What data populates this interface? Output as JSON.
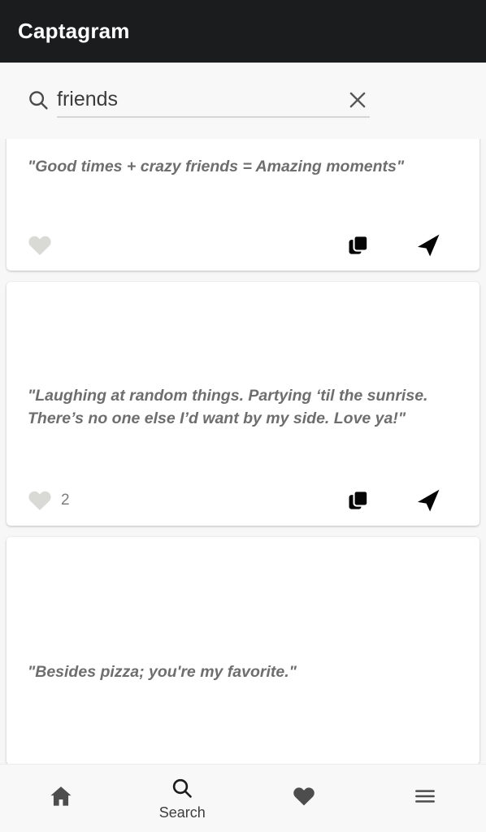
{
  "app": {
    "title": "Captagram",
    "appbar_bg": "#1b1c1e",
    "page_bg": "#f7f7f7",
    "quote_color": "#6e6e6e"
  },
  "search": {
    "icon": "search-icon",
    "value": "friends",
    "placeholder": "Search",
    "clear_icon": "close-icon"
  },
  "feed": {
    "cards": [
      {
        "quote": "\"Good times + crazy friends = Amazing moments\"",
        "like_icon": "heart-icon",
        "like_count": "",
        "copy_icon": "copy-icon",
        "share_icon": "send-icon"
      },
      {
        "quote": "\"Laughing at random things. Partying ‘til the sunrise. There’s no one else I’d want by my side. Love ya!\"",
        "like_icon": "heart-icon",
        "like_count": "2",
        "copy_icon": "copy-icon",
        "share_icon": "send-icon"
      },
      {
        "quote": "\"Besides pizza; you're my favorite.\"",
        "like_icon": "heart-icon",
        "like_count": "",
        "copy_icon": "copy-icon",
        "share_icon": "send-icon"
      }
    ]
  },
  "bottom_nav": {
    "items": [
      {
        "icon": "home-icon",
        "label": ""
      },
      {
        "icon": "search-icon",
        "label": "Search"
      },
      {
        "icon": "heart-icon",
        "label": ""
      },
      {
        "icon": "menu-icon",
        "label": ""
      }
    ]
  }
}
